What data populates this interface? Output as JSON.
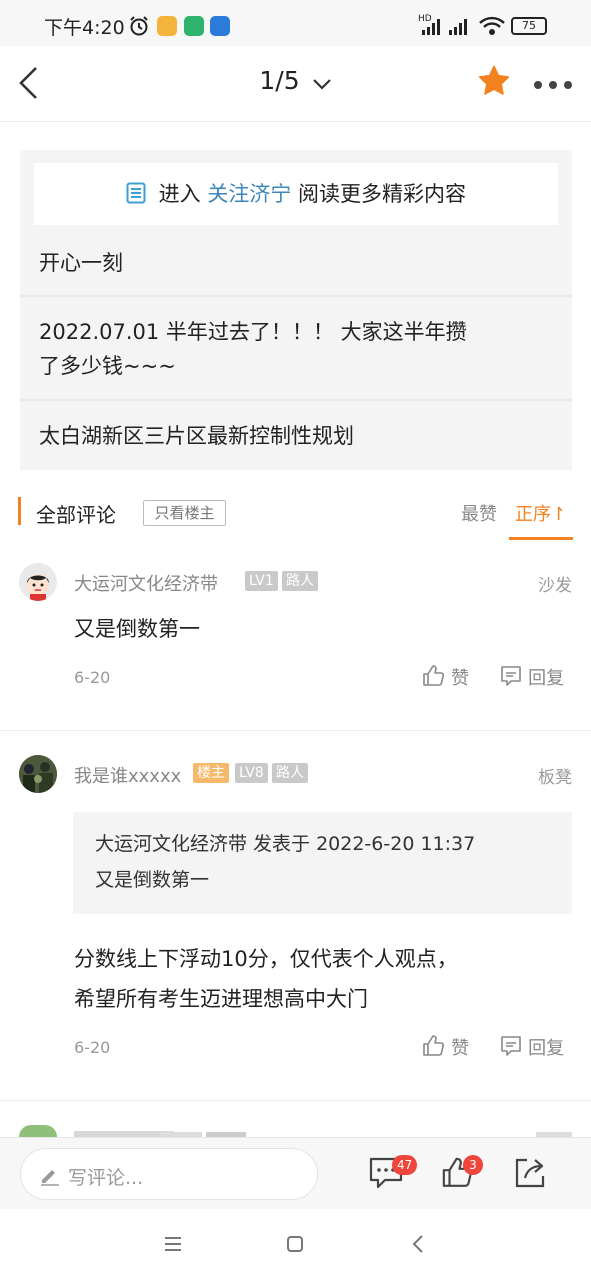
{
  "status": {
    "time": "下午4:20",
    "battery": "75",
    "network": "HD"
  },
  "nav": {
    "pager": "1/5"
  },
  "banner": {
    "prefix": "进入",
    "link": "关注济宁",
    "suffix": "阅读更多精彩内容"
  },
  "related": [
    {
      "title": "开心一刻"
    },
    {
      "title_line1": "2022.07.01 半年过去了！！！ 大家这半年攒",
      "title_line2": "了多少钱~~~"
    },
    {
      "title": "太白湖新区三片区最新控制性规划"
    }
  ],
  "comments_header": {
    "title": "全部评论",
    "only_host": "只看楼主",
    "sort_hot": "最赞",
    "sort_asc": "正序↾"
  },
  "comments": [
    {
      "user": "大运河文化经济带",
      "badges": [
        "LV1",
        "路人"
      ],
      "floor": "沙发",
      "body": "又是倒数第一",
      "date": "6-20",
      "like": "赞",
      "reply": "回复"
    },
    {
      "user": "我是谁xxxxx",
      "badges": [
        "楼主",
        "LV8",
        "路人"
      ],
      "floor": "板凳",
      "quote_line1": "大运河文化经济带 发表于 2022-6-20 11:37",
      "quote_line2": "又是倒数第一",
      "body_line1": "分数线上下浮动10分，仅代表个人观点，",
      "body_line2": "希望所有考生迈进理想高中大门",
      "date": "6-20",
      "like": "赞",
      "reply": "回复"
    }
  ],
  "bottom": {
    "placeholder": "写评论...",
    "comment_count": "47",
    "like_count": "3"
  },
  "colors": {
    "accent": "#f2821f",
    "link": "#3d87b8",
    "badge_red": "#f0453a"
  }
}
